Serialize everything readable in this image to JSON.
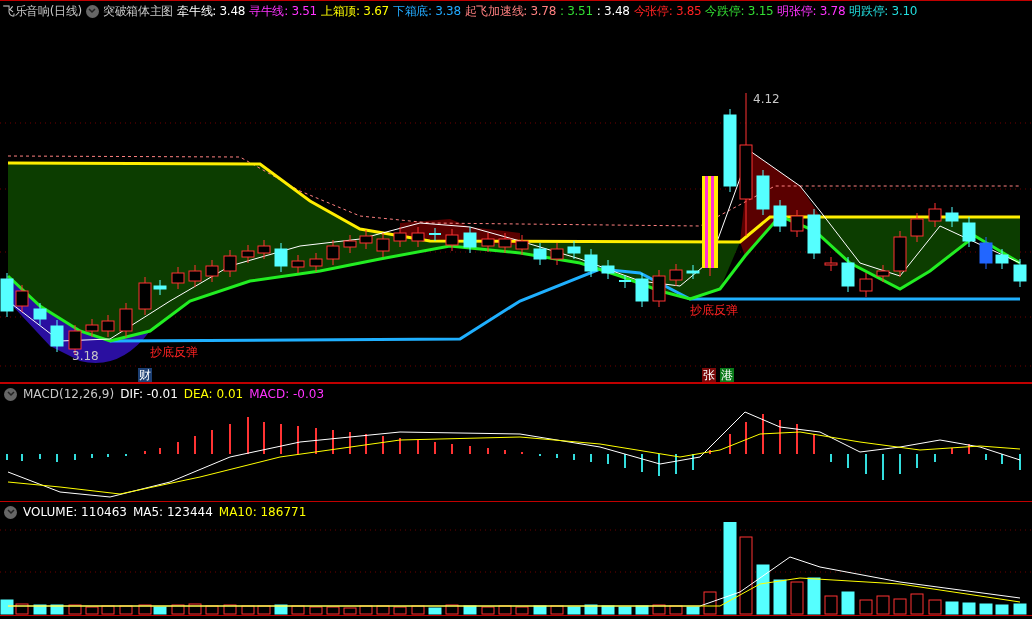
{
  "header": {
    "title": "飞乐音响(日线)",
    "indicator": "突破箱体主图",
    "values": [
      {
        "text": "牵牛线: 3.48",
        "color": "#ffffff"
      },
      {
        "text": "寻牛线: 3.51",
        "color": "#ff33ff"
      },
      {
        "text": "上箱顶: 3.67",
        "color": "#ffff00"
      },
      {
        "text": "下箱底: 3.38",
        "color": "#22aaff"
      },
      {
        "text": "起飞加速线: 3.78",
        "color": "#ff8080"
      },
      {
        "text": ": 3.51",
        "color": "#33dd33"
      },
      {
        "text": ": 3.48",
        "color": "#ffffff"
      },
      {
        "text": "今张停: 3.85",
        "color": "#ff2222"
      },
      {
        "text": "今跌停: 3.15",
        "color": "#33dd33"
      },
      {
        "text": "明张停: 3.78",
        "color": "#ff33ff"
      },
      {
        "text": "明跌停: 3.10",
        "color": "#22dddd"
      }
    ]
  },
  "main_chart": {
    "high_label": "4.12",
    "low_label": "3.18",
    "signals": [
      "抄底反弹",
      "抄底反弹"
    ],
    "events": [
      {
        "text": "财",
        "color": "#1c3f73"
      },
      {
        "text": "张",
        "color": "#7a0a0a"
      },
      {
        "text": "港",
        "color": "#0a7a1a"
      }
    ]
  },
  "macd": {
    "values": [
      {
        "text": "MACD(12,26,9)",
        "color": "#c8c8c8"
      },
      {
        "text": "DIF: -0.01",
        "color": "#ffffff"
      },
      {
        "text": "DEA: 0.01",
        "color": "#ffff00"
      },
      {
        "text": "MACD: -0.03",
        "color": "#ff33ff"
      }
    ]
  },
  "volume": {
    "values": [
      {
        "text": "VOLUME: 110463",
        "color": "#ffffff"
      },
      {
        "text": "MA5: 123444",
        "color": "#ffffff"
      },
      {
        "text": "MA10: 186771",
        "color": "#ffff00"
      }
    ]
  }
}
